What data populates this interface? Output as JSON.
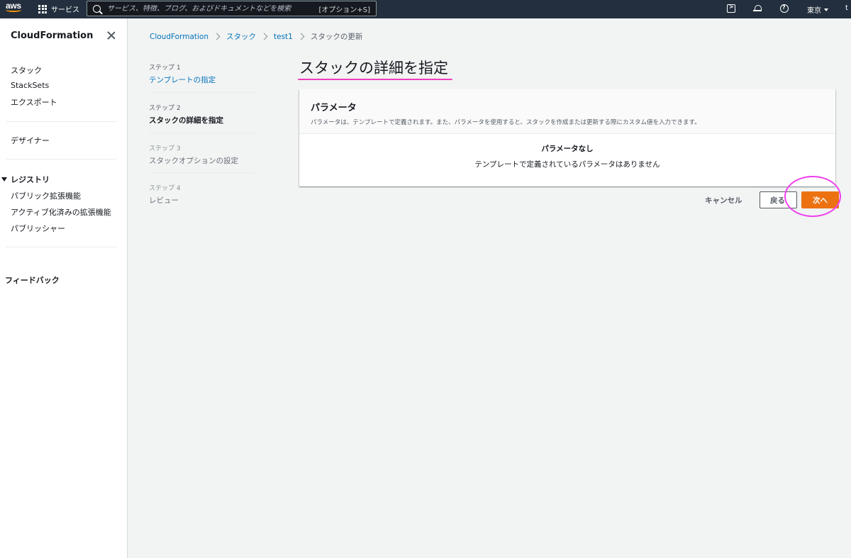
{
  "topnav": {
    "logo_text": "aws",
    "services_label": "サービス",
    "search_placeholder": "サービス、特徴、ブログ、およびドキュメントなどを検索",
    "search_shortcut": "[オプション+S]",
    "region": "東京",
    "account": "t"
  },
  "sidebar": {
    "title": "CloudFormation",
    "items": [
      {
        "label": "スタック"
      },
      {
        "label": "StackSets"
      },
      {
        "label": "エクスポート"
      }
    ],
    "designer": "デザイナー",
    "registry": {
      "label": "レジストリ",
      "items": [
        {
          "label": "パブリック拡張機能"
        },
        {
          "label": "アクティブ化済みの拡張機能"
        },
        {
          "label": "パブリッシャー"
        }
      ]
    },
    "feedback": "フィードバック"
  },
  "breadcrumb": {
    "items": [
      "CloudFormation",
      "スタック",
      "test1"
    ],
    "current": "スタックの更新"
  },
  "steps": [
    {
      "num": "ステップ 1",
      "label": "テンプレートの指定",
      "state": "link"
    },
    {
      "num": "ステップ 2",
      "label": "スタックの詳細を指定",
      "state": "active"
    },
    {
      "num": "ステップ 3",
      "label": "スタックオプションの設定",
      "state": "disabled"
    },
    {
      "num": "ステップ 4",
      "label": "レビュー",
      "state": "disabled"
    }
  ],
  "main": {
    "title": "スタックの詳細を指定",
    "panel": {
      "title": "パラメータ",
      "description": "パラメータは、テンプレートで定義されます。また、パラメータを使用すると、スタックを作成または更新する際にカスタム値を入力できます。",
      "empty_title": "パラメータなし",
      "empty_desc": "テンプレートで定義されているパラメータはありません"
    },
    "actions": {
      "cancel": "キャンセル",
      "back": "戻る",
      "next": "次へ"
    }
  },
  "colors": {
    "nav_bg": "#232f3e",
    "link": "#0073bb",
    "primary_button": "#ec7211",
    "annotation": "#ee3fee"
  }
}
